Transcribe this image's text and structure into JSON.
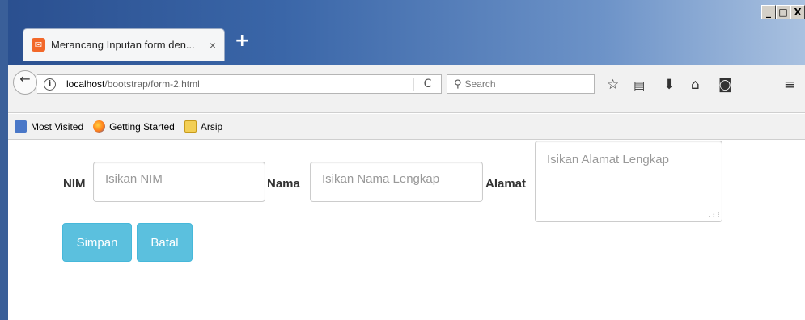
{
  "window": {
    "controls": [
      "_",
      "□",
      "X"
    ],
    "tab": {
      "title": "Merancang Inputan form den...",
      "close": "×",
      "new_tab": "+"
    }
  },
  "navbar": {
    "back": "←",
    "info": "i",
    "url_host": "localhost",
    "url_path": "/bootstrap/form-2.html",
    "reload": "C",
    "search_placeholder": "Search",
    "icons": [
      "star-icon",
      "reading-list-icon",
      "download-icon",
      "home-icon",
      "pocket-icon",
      "menu-icon"
    ]
  },
  "bookmarks": [
    {
      "label": "Most Visited",
      "icon": "most-visited-icon"
    },
    {
      "label": "Getting Started",
      "icon": "firefox-icon"
    },
    {
      "label": "Arsip",
      "icon": "folder-icon"
    }
  ],
  "form": {
    "nim_label": "NIM",
    "nim_placeholder": "Isikan NIM",
    "nama_label": "Nama",
    "nama_placeholder": "Isikan Nama Lengkap",
    "alamat_label": "Alamat",
    "alamat_placeholder": "Isikan Alamat Lengkap",
    "simpan_label": "Simpan",
    "batal_label": "Batal"
  },
  "colors": {
    "button": "#5bc0de",
    "titlebar": "#3a66a8"
  }
}
